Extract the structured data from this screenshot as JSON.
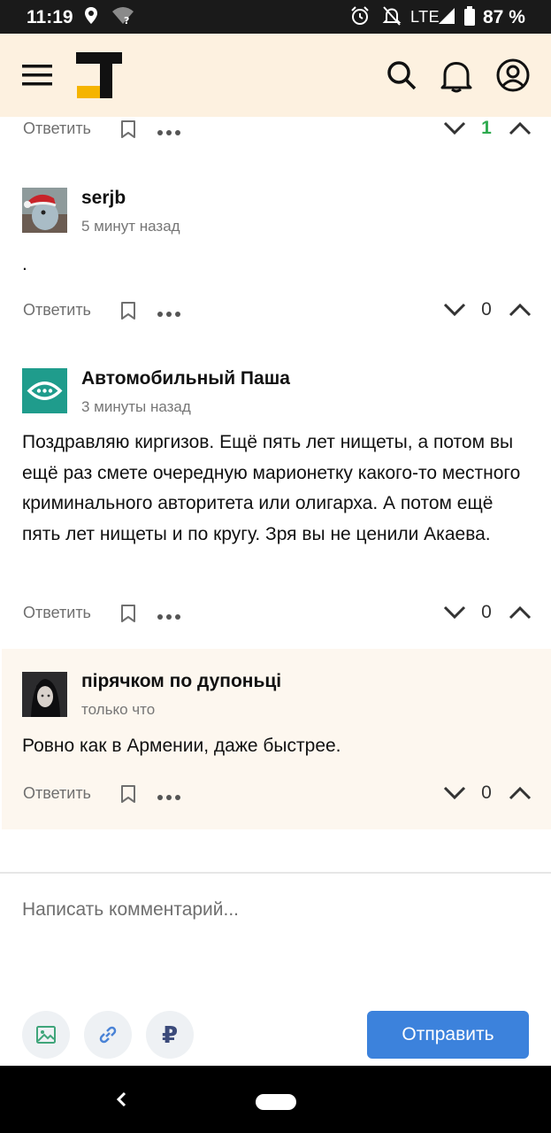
{
  "status_bar": {
    "time": "11:19",
    "network": "LTE",
    "battery": "87 %"
  },
  "app_bar": {
    "icons": [
      "menu-icon",
      "tj-logo",
      "search-icon",
      "bell-icon",
      "profile-icon"
    ],
    "logo_accent_color": "#f5b400"
  },
  "comments": [
    {
      "author": "serjb",
      "time": "5 минут назад",
      "text": ".",
      "reply_label": "Ответить",
      "votes": "0"
    },
    {
      "author": "Автомобильный Паша",
      "time": "3 минуты назад",
      "text": "Поздравляю киргизов. Ещё пять лет нищеты, а потом вы ещё раз смете очередную марионетку какого-то местного криминального авторитета или олигарха. А потом ещё пять лет нищеты и по кругу. Зря вы не ценили Акаева.",
      "reply_label": "Ответить",
      "votes": "0"
    },
    {
      "author": "пірячком по дупоньці",
      "time": "только что",
      "text": "Ровно как в Армении, даже быстрее.",
      "reply_label": "Ответить",
      "votes": "0"
    }
  ],
  "top_action_row": {
    "reply_label": "Ответить",
    "votes": "1"
  },
  "composer": {
    "placeholder": "Написать комментарий...",
    "currency_symbol": "₽",
    "send_label": "Отправить"
  },
  "colors": {
    "accent": "#3c82dc",
    "positive_vote": "#2eaa4f",
    "header_bg": "#fdf1e0",
    "highlight_bg": "#fdf7ef"
  }
}
